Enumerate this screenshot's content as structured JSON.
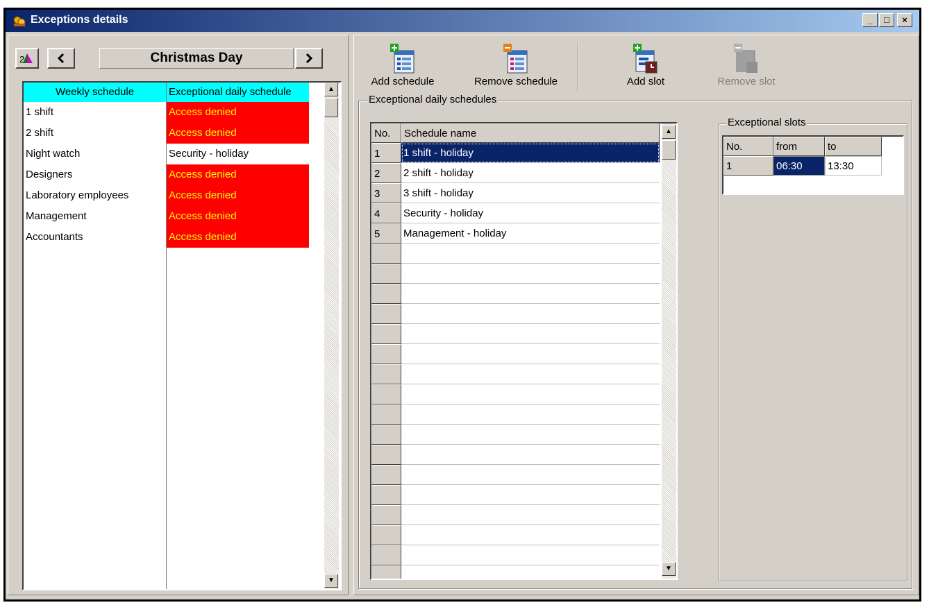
{
  "window": {
    "title": "Exceptions details",
    "controls": {
      "minimize": "_",
      "maximize": "□",
      "close": "×"
    }
  },
  "nav": {
    "day_title": "Christmas Day",
    "prev_icon": "chevron-left-icon",
    "next_icon": "chevron-right-icon"
  },
  "left_table": {
    "columns": [
      "Weekly schedule",
      "Exceptional daily schedule"
    ],
    "rows": [
      {
        "weekly": "1 shift",
        "daily": "Access denied",
        "denied": true
      },
      {
        "weekly": "2 shift",
        "daily": "Access denied",
        "denied": true
      },
      {
        "weekly": "Night watch",
        "daily": "Security - holiday",
        "denied": false
      },
      {
        "weekly": "Designers",
        "daily": "Access denied",
        "denied": true
      },
      {
        "weekly": "Laboratory employees",
        "daily": "Access denied",
        "denied": true
      },
      {
        "weekly": "Management",
        "daily": "Access denied",
        "denied": true
      },
      {
        "weekly": "Accountants",
        "daily": "Access denied",
        "denied": true
      }
    ]
  },
  "toolbar": {
    "add_schedule": "Add schedule",
    "remove_schedule": "Remove schedule",
    "add_slot": "Add slot",
    "remove_slot": "Remove slot"
  },
  "schedules": {
    "group_label": "Exceptional daily schedules",
    "columns": [
      "No.",
      "Schedule name"
    ],
    "rows": [
      {
        "no": "1",
        "name": "1 shift - holiday",
        "selected": true
      },
      {
        "no": "2",
        "name": "2 shift - holiday"
      },
      {
        "no": "3",
        "name": "3 shift - holiday"
      },
      {
        "no": "4",
        "name": "Security - holiday"
      },
      {
        "no": "5",
        "name": "Management - holiday"
      }
    ]
  },
  "slots": {
    "group_label": "Exceptional slots",
    "columns": [
      "No.",
      "from",
      "to"
    ],
    "rows": [
      {
        "no": "1",
        "from": "06:30",
        "to": "13:30"
      }
    ]
  },
  "colors": {
    "header_cyan": "#00ffff",
    "denied_bg": "#ff0000",
    "denied_text": "#ffff00",
    "selection": "#0a246a"
  }
}
